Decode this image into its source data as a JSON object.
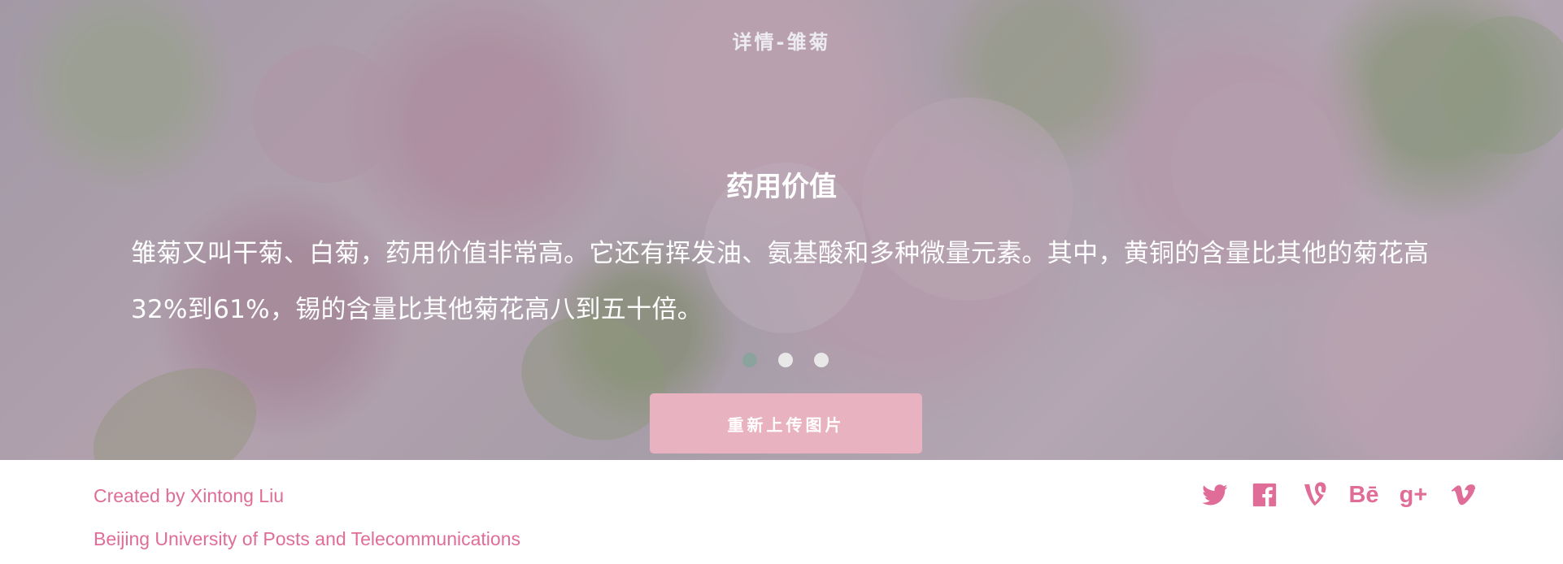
{
  "page": {
    "title": "详情-雏菊"
  },
  "content": {
    "heading": "药用价值",
    "paragraph": "雏菊又叫干菊、白菊，药用价值非常高。它还有挥发油、氨基酸和多种微量元素。其中，黄铜的含量比其他的菊花高32%到61%，锡的含量比其他菊花高八到五十倍。"
  },
  "carousel": {
    "current_slide": 1,
    "total_slides": 3
  },
  "actions": {
    "reupload_label": "重新上传图片"
  },
  "footer": {
    "creator": "Created by Xintong Liu",
    "institution": "Beijing University of Posts and Telecommunications",
    "social_icons": [
      "twitter-icon",
      "facebook-icon",
      "vine-icon",
      "behance-icon",
      "google-plus-icon",
      "vimeo-icon"
    ],
    "behance_glyph": "Bē",
    "google_plus_glyph": "g+"
  },
  "colors": {
    "accent_pink": "#df6d97",
    "button_pink": "#e9b2c0",
    "active_dot": "#8aa39d",
    "inactive_dot": "#e8e8e8"
  }
}
